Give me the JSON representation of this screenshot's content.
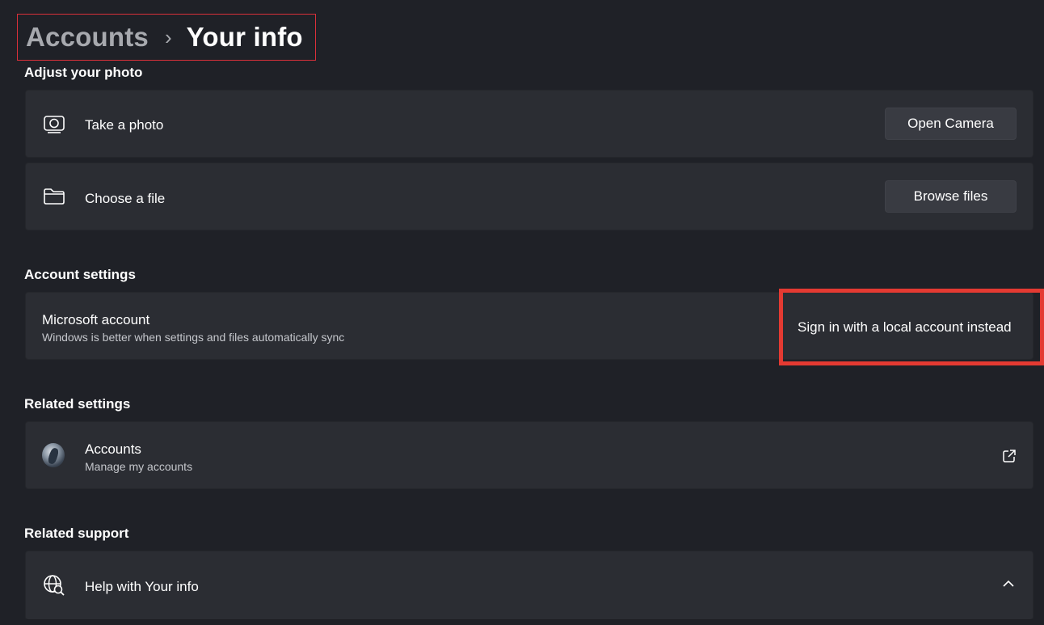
{
  "breadcrumb": {
    "parent": "Accounts",
    "separator": "›",
    "current": "Your info"
  },
  "sections": {
    "adjust_photo": "Adjust your photo",
    "account_settings": "Account settings",
    "related_settings": "Related settings",
    "related_support": "Related support"
  },
  "photo_options": {
    "take_photo": {
      "label": "Take a photo",
      "button": "Open Camera",
      "icon": "camera-icon"
    },
    "choose_file": {
      "label": "Choose a file",
      "button": "Browse files",
      "icon": "folder-icon"
    }
  },
  "microsoft_account": {
    "title": "Microsoft account",
    "subtitle": "Windows is better when settings and files automatically sync",
    "action": "Sign in with a local account instead"
  },
  "related": {
    "accounts": {
      "title": "Accounts",
      "subtitle": "Manage my accounts",
      "icon": "avatar",
      "action_icon": "external-link-icon"
    }
  },
  "support": {
    "help": {
      "label": "Help with Your info",
      "icon": "globe-search-icon",
      "expand_icon": "chevron-up-icon"
    }
  },
  "colors": {
    "background": "#1f2127",
    "card": "#2b2d33",
    "highlight_red": "#e43a32",
    "breadcrumb_border": "#d9303a"
  }
}
